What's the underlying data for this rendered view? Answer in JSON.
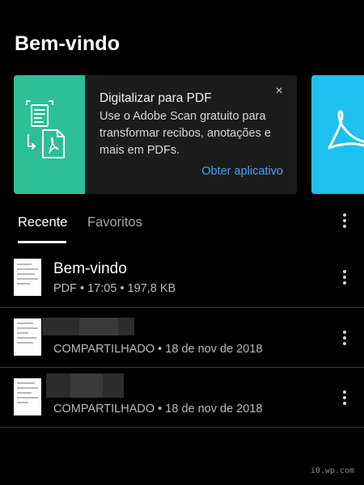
{
  "header": {
    "title": "Bem-vindo"
  },
  "promo": {
    "title": "Digitalizar para PDF",
    "body": "Use o Adobe Scan gratuito para transformar recibos, anotações e mais em PDFs.",
    "cta": "Obter aplicativo",
    "close": "×"
  },
  "tabs": [
    {
      "label": "Recente",
      "active": true
    },
    {
      "label": "Favoritos",
      "active": false
    }
  ],
  "files": [
    {
      "name": "Bem-vindo",
      "type": "PDF",
      "time": "17:05",
      "size": "197,8 KB",
      "meta": "PDF  •  17:05  •  197,8 KB"
    },
    {
      "name": "",
      "meta": "COMPARTILHADO  •  18 de nov de 2018"
    },
    {
      "name": "",
      "meta": "COMPARTILHADO  •  18 de nov de 2018"
    }
  ],
  "watermark": "i0.wp.com",
  "colors": {
    "accent": "#4a9ff1",
    "scan_green": "#2dbf96",
    "acrobat_blue": "#1ec0ef",
    "background": "#000000"
  },
  "icons": {
    "scan": "scan-to-pdf-icon",
    "acrobat": "acrobat-logo-icon",
    "close": "close-icon",
    "more": "more-vertical-icon"
  }
}
